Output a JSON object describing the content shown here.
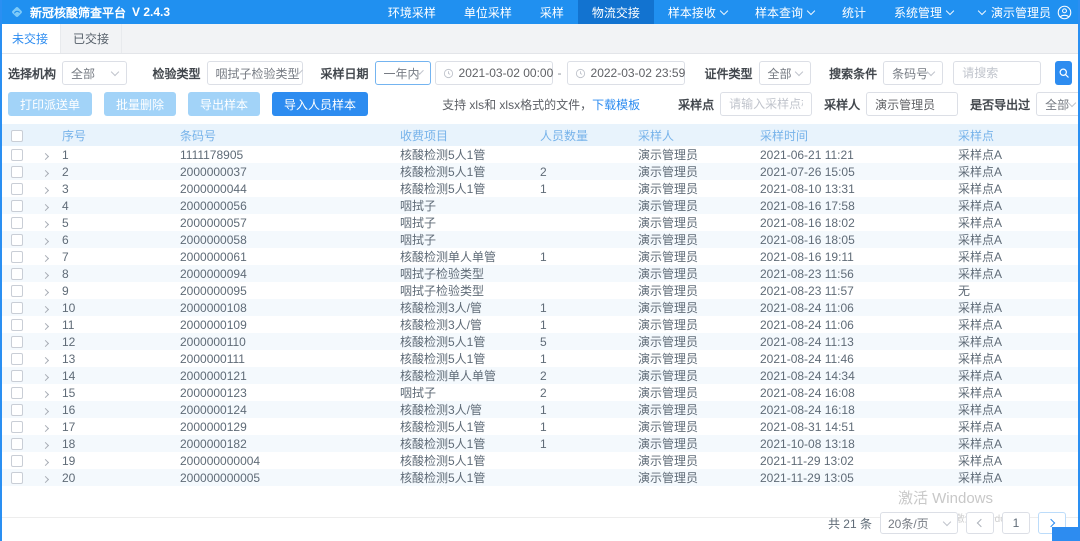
{
  "app": {
    "title": "新冠核酸筛查平台",
    "version": "V 2.4.3"
  },
  "colors": {
    "primary": "#2090f0",
    "nav_active": "#1273d0",
    "link": "#2d8cf0",
    "table_header_bg": "#e8f3fc",
    "table_header_text": "#77b3ea",
    "stripe": "#f4f9fd"
  },
  "nav": {
    "items": [
      {
        "label": "环境采样",
        "active": false,
        "dropdown": false
      },
      {
        "label": "单位采样",
        "active": false,
        "dropdown": false
      },
      {
        "label": "采样",
        "active": false,
        "dropdown": false
      },
      {
        "label": "物流交接",
        "active": true,
        "dropdown": false
      },
      {
        "label": "样本接收",
        "active": false,
        "dropdown": true
      },
      {
        "label": "样本查询",
        "active": false,
        "dropdown": true
      },
      {
        "label": "统计",
        "active": false,
        "dropdown": false
      },
      {
        "label": "系统管理",
        "active": false,
        "dropdown": true
      }
    ],
    "user": {
      "name": "演示管理员"
    }
  },
  "tabs": [
    {
      "label": "未交接",
      "active": true
    },
    {
      "label": "已交接",
      "active": false
    }
  ],
  "filters": {
    "org_label": "选择机构",
    "org_value": "全部",
    "type_label": "检验类型",
    "type_value": "咽拭子检验类型",
    "date_label": "采样日期",
    "date_preset": "一年内",
    "date_start": "2021-03-02 00:00",
    "date_separator": "-",
    "date_end": "2022-03-02 23:59",
    "cert_label": "证件类型",
    "cert_value": "全部",
    "search_label": "搜索条件",
    "search_field": "条码号",
    "search_placeholder": "请搜索",
    "site_label": "采样点",
    "site_placeholder": "请输入采样点检索",
    "sampler_label": "采样人",
    "sampler_value": "演示管理员",
    "exported_label": "是否导出过",
    "exported_value": "全部"
  },
  "toolbar": {
    "print_label": "打印派送单",
    "delete_label": "批量删除",
    "export_label": "导出样本",
    "import_label": "导入人员样本",
    "hint": "支持 xls和 xlsx格式的文件，",
    "template_link": "下载模板"
  },
  "table": {
    "columns": {
      "index": "序号",
      "barcode": "条码号",
      "item": "收费项目",
      "people": "人员数量",
      "sampler": "采样人",
      "time": "采样时间",
      "site": "采样点"
    },
    "rows": [
      {
        "index": "1",
        "barcode": "1111178905",
        "item": "核酸检测5人1管",
        "people": "",
        "sampler": "演示管理员",
        "time": "2021-06-21 11:21",
        "site": "采样点A"
      },
      {
        "index": "2",
        "barcode": "2000000037",
        "item": "核酸检测5人1管",
        "people": "2",
        "sampler": "演示管理员",
        "time": "2021-07-26 15:05",
        "site": "采样点A"
      },
      {
        "index": "3",
        "barcode": "2000000044",
        "item": "核酸检测5人1管",
        "people": "1",
        "sampler": "演示管理员",
        "time": "2021-08-10 13:31",
        "site": "采样点A"
      },
      {
        "index": "4",
        "barcode": "2000000056",
        "item": "咽拭子",
        "people": "",
        "sampler": "演示管理员",
        "time": "2021-08-16 17:58",
        "site": "采样点A"
      },
      {
        "index": "5",
        "barcode": "2000000057",
        "item": "咽拭子",
        "people": "",
        "sampler": "演示管理员",
        "time": "2021-08-16 18:02",
        "site": "采样点A"
      },
      {
        "index": "6",
        "barcode": "2000000058",
        "item": "咽拭子",
        "people": "",
        "sampler": "演示管理员",
        "time": "2021-08-16 18:05",
        "site": "采样点A"
      },
      {
        "index": "7",
        "barcode": "2000000061",
        "item": "核酸检测单人单管",
        "people": "1",
        "sampler": "演示管理员",
        "time": "2021-08-16 19:11",
        "site": "采样点A"
      },
      {
        "index": "8",
        "barcode": "2000000094",
        "item": "咽拭子检验类型",
        "people": "",
        "sampler": "演示管理员",
        "time": "2021-08-23 11:56",
        "site": "采样点A"
      },
      {
        "index": "9",
        "barcode": "2000000095",
        "item": "咽拭子检验类型",
        "people": "",
        "sampler": "演示管理员",
        "time": "2021-08-23 11:57",
        "site": "无"
      },
      {
        "index": "10",
        "barcode": "2000000108",
        "item": "核酸检测3人/管",
        "people": "1",
        "sampler": "演示管理员",
        "time": "2021-08-24 11:06",
        "site": "采样点A"
      },
      {
        "index": "11",
        "barcode": "2000000109",
        "item": "核酸检测3人/管",
        "people": "1",
        "sampler": "演示管理员",
        "time": "2021-08-24 11:06",
        "site": "采样点A"
      },
      {
        "index": "12",
        "barcode": "2000000110",
        "item": "核酸检测5人1管",
        "people": "5",
        "sampler": "演示管理员",
        "time": "2021-08-24 11:13",
        "site": "采样点A"
      },
      {
        "index": "13",
        "barcode": "2000000111",
        "item": "核酸检测5人1管",
        "people": "1",
        "sampler": "演示管理员",
        "time": "2021-08-24 11:46",
        "site": "采样点A"
      },
      {
        "index": "14",
        "barcode": "2000000121",
        "item": "核酸检测单人单管",
        "people": "2",
        "sampler": "演示管理员",
        "time": "2021-08-24 14:34",
        "site": "采样点A"
      },
      {
        "index": "15",
        "barcode": "2000000123",
        "item": "咽拭子",
        "people": "2",
        "sampler": "演示管理员",
        "time": "2021-08-24 16:08",
        "site": "采样点A"
      },
      {
        "index": "16",
        "barcode": "2000000124",
        "item": "核酸检测3人/管",
        "people": "1",
        "sampler": "演示管理员",
        "time": "2021-08-24 16:18",
        "site": "采样点A"
      },
      {
        "index": "17",
        "barcode": "2000000129",
        "item": "核酸检测5人1管",
        "people": "1",
        "sampler": "演示管理员",
        "time": "2021-08-31 14:51",
        "site": "采样点A"
      },
      {
        "index": "18",
        "barcode": "2000000182",
        "item": "核酸检测5人1管",
        "people": "1",
        "sampler": "演示管理员",
        "time": "2021-10-08 13:18",
        "site": "采样点A"
      },
      {
        "index": "19",
        "barcode": "200000000004",
        "item": "核酸检测5人1管",
        "people": "",
        "sampler": "演示管理员",
        "time": "2021-11-29 13:02",
        "site": "采样点A"
      },
      {
        "index": "20",
        "barcode": "200000000005",
        "item": "核酸检测5人1管",
        "people": "",
        "sampler": "演示管理员",
        "time": "2021-11-29 13:05",
        "site": "采样点A"
      }
    ]
  },
  "pagination": {
    "total_text": "共 21 条",
    "page_size": "20条/页",
    "current_page": "1"
  },
  "watermark": {
    "line1": "激活 Windows",
    "line2": "转到“设置”以激活 Windows。"
  }
}
